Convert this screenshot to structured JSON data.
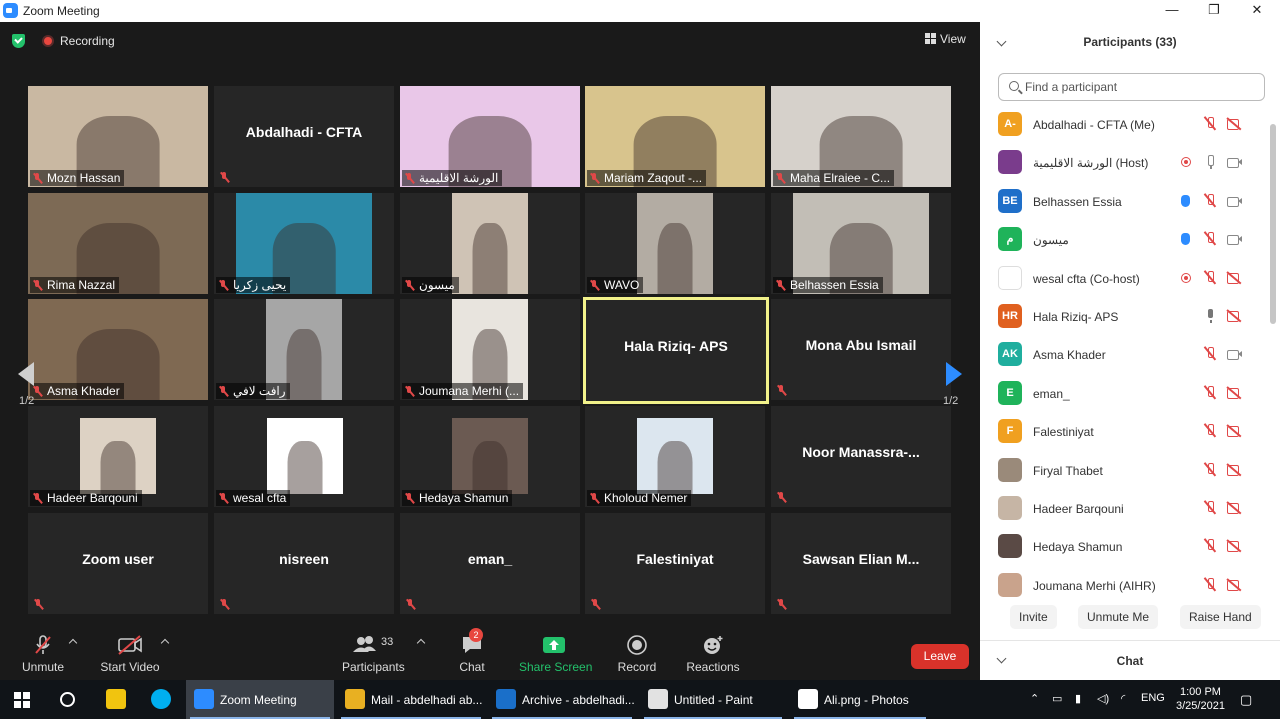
{
  "window": {
    "title": "Zoom Meeting",
    "minimize": "—",
    "restore": "❐",
    "close": "✕"
  },
  "meeting": {
    "recording_label": "Recording",
    "view_label": "View",
    "page_left": "1/2",
    "page_right": "1/2",
    "tiles": [
      {
        "name": "Mozn Hassan",
        "video": true,
        "photo_bg": "#c9b8a2"
      },
      {
        "name": "Abdalhadi - CFTA",
        "video": false
      },
      {
        "name": "الورشة الاقليمية",
        "video": true,
        "photo_bg": "#e9c7e8"
      },
      {
        "name": "Mariam Zaqout -...",
        "video": true,
        "photo_bg": "#d8c48d"
      },
      {
        "name": "Maha Elraiee - C...",
        "video": true,
        "photo_bg": "#d6d1cb"
      },
      {
        "name": "Rima Nazzal",
        "video": true,
        "photo_bg": "#7d6a55"
      },
      {
        "name": "يحيى زكريا",
        "video": true,
        "photo_bg": "#2b8aa8"
      },
      {
        "name": "ميسون",
        "video": true,
        "photo_bg": "#cfc3b5"
      },
      {
        "name": "WAVO",
        "video": true,
        "photo_bg": "#b3aca3"
      },
      {
        "name": "Belhassen Essia",
        "video": true,
        "photo_bg": "#c2beb6"
      },
      {
        "name": "Asma Khader",
        "video": true,
        "photo_bg": "#7f6952"
      },
      {
        "name": "رافت لافي",
        "video": true,
        "photo_bg": "#a6a6a6"
      },
      {
        "name": "Joumana Merhi (...",
        "video": true,
        "photo_bg": "#e8e4de"
      },
      {
        "name": "Hala Riziq-  APS",
        "video": false,
        "active": true
      },
      {
        "name": "Mona Abu Ismail",
        "video": false
      },
      {
        "name": "Hadeer Barqouni",
        "video": true,
        "photo_bg": "#ddd2c4"
      },
      {
        "name": "wesal cfta",
        "video": true,
        "photo_bg": "#ffffff"
      },
      {
        "name": "Hedaya Shamun",
        "video": true,
        "photo_bg": "#6b5a52"
      },
      {
        "name": "Kholoud Nemer",
        "video": true,
        "photo_bg": "#dce6ef"
      },
      {
        "name": "Noor  Manassra-...",
        "video": false
      },
      {
        "name": "Zoom user",
        "video": false
      },
      {
        "name": "nisreen",
        "video": false
      },
      {
        "name": "eman_",
        "video": false
      },
      {
        "name": "Falestiniyat",
        "video": false
      },
      {
        "name": "Sawsan  Elian  M...",
        "video": false
      }
    ]
  },
  "toolbar": {
    "unmute": "Unmute",
    "start_video": "Start Video",
    "participants": "Participants",
    "participants_count": "33",
    "chat": "Chat",
    "chat_badge": "2",
    "share_screen": "Share Screen",
    "record": "Record",
    "reactions": "Reactions",
    "leave": "Leave"
  },
  "sidebar": {
    "title": "Participants (33)",
    "search_placeholder": "Find a participant",
    "participants": [
      {
        "name": "Abdalhadi - CFTA (Me)",
        "initials": "A-",
        "color": "#f0a020",
        "icons": [
          "mic-muted",
          "cam-off"
        ]
      },
      {
        "name": "الورشة الاقليمية (Host)",
        "initials": "",
        "color": "#7a3c8c",
        "icons": [
          "rec",
          "mic",
          "cam"
        ]
      },
      {
        "name": "Belhassen Essia",
        "initials": "BE",
        "color": "#1f6fc9",
        "icons": [
          "hand",
          "mic-muted",
          "cam"
        ]
      },
      {
        "name": "ميسون",
        "initials": "م",
        "color": "#1fb35a",
        "icons": [
          "hand",
          "mic-muted",
          "cam"
        ]
      },
      {
        "name": "wesal cfta (Co-host)",
        "initials": "",
        "color": "#ffffff",
        "icons": [
          "rec",
          "mic-muted",
          "cam-off"
        ]
      },
      {
        "name": "Hala Riziq-  APS",
        "initials": "HR",
        "color": "#e0601f",
        "icons": [
          "mic-active",
          "cam-off"
        ]
      },
      {
        "name": "Asma Khader",
        "initials": "AK",
        "color": "#1fae9e",
        "icons": [
          "mic-muted",
          "cam"
        ]
      },
      {
        "name": "eman_",
        "initials": "E",
        "color": "#1fb35a",
        "icons": [
          "mic-muted",
          "cam-off"
        ]
      },
      {
        "name": "Falestiniyat",
        "initials": "F",
        "color": "#f0a020",
        "icons": [
          "mic-muted",
          "cam-off"
        ]
      },
      {
        "name": "Firyal Thabet",
        "initials": "",
        "color": "#9a8a7a",
        "icons": [
          "mic-muted",
          "cam-off"
        ]
      },
      {
        "name": "Hadeer Barqouni",
        "initials": "",
        "color": "#c6b5a5",
        "icons": [
          "mic-muted",
          "cam-off"
        ]
      },
      {
        "name": "Hedaya Shamun",
        "initials": "",
        "color": "#5a4a45",
        "icons": [
          "mic-muted",
          "cam-off"
        ]
      },
      {
        "name": "Joumana Merhi (AIHR)",
        "initials": "",
        "color": "#c9a38c",
        "icons": [
          "mic-muted",
          "cam-off"
        ]
      }
    ],
    "invite": "Invite",
    "unmute_me": "Unmute Me",
    "raise_hand": "Raise Hand",
    "chat_title": "Chat"
  },
  "taskbar": {
    "items": [
      {
        "label": "Zoom Meeting",
        "color": "#2d8cff",
        "active": true
      },
      {
        "label": "Mail - abdelhadi ab...",
        "color": "#e8b022",
        "active": false
      },
      {
        "label": "Archive - abdelhadi...",
        "color": "#1a6fc9",
        "active": false
      },
      {
        "label": "Untitled - Paint",
        "color": "#e2e2e2",
        "active": false
      },
      {
        "label": "Ali.png - Photos",
        "color": "#ffffff",
        "active": false
      }
    ],
    "language": "ENG",
    "time": "1:00 PM",
    "date": "3/25/2021"
  }
}
